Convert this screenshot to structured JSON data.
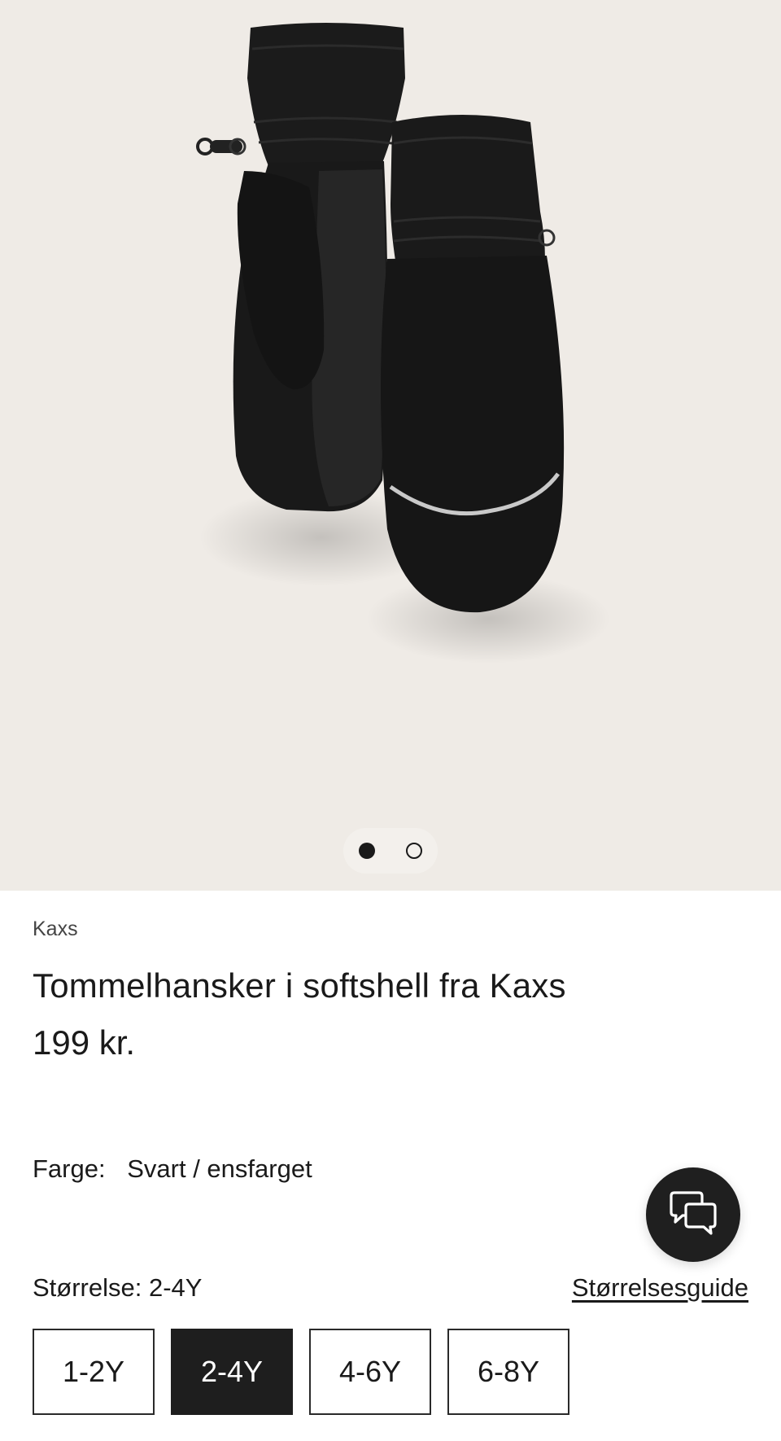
{
  "product": {
    "brand": "Kaxs",
    "title": "Tommelhansker i softshell fra Kaxs",
    "price": "199 kr."
  },
  "gallery": {
    "image_icon": "black-mitten-pair-image",
    "active_index": 1,
    "total": 2
  },
  "color": {
    "label": "Farge:",
    "value": "Svart / ensfarget"
  },
  "size": {
    "label": "Størrelse: 2-4Y",
    "guide_label": "Størrelsesguide",
    "options": [
      "1-2Y",
      "2-4Y",
      "4-6Y",
      "6-8Y"
    ],
    "selected": "2-4Y"
  },
  "chat": {
    "icon": "chat-bubbles-icon"
  },
  "colors": {
    "hero_bg": "#efebe6",
    "selected_bg": "#1e1e1e",
    "text": "#1a1a1a"
  }
}
